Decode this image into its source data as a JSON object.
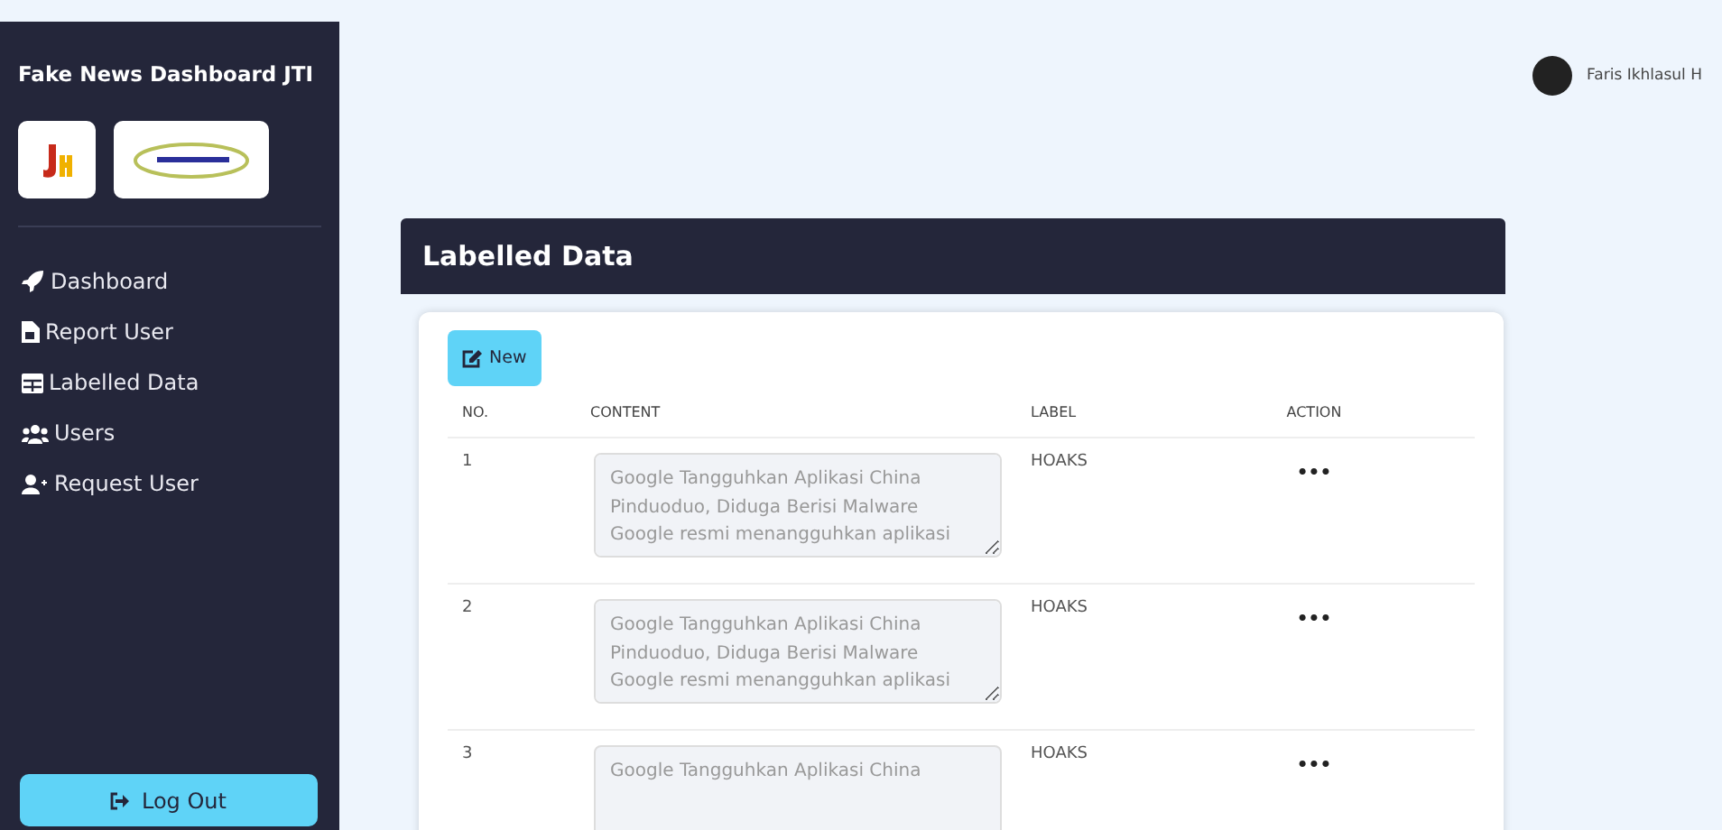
{
  "sidebar": {
    "title": "Fake News Dashboard JTI",
    "nav": [
      {
        "label": "Dashboard"
      },
      {
        "label": "Report User"
      },
      {
        "label": "Labelled Data"
      },
      {
        "label": "Users"
      },
      {
        "label": "Request User"
      }
    ],
    "logout": "Log Out"
  },
  "user": {
    "name": "Faris Ikhlasul H"
  },
  "page": {
    "title": "Labelled Data",
    "new_button": "New",
    "table": {
      "columns": [
        "NO.",
        "CONTENT",
        "LABEL",
        "ACTION"
      ],
      "rows": [
        {
          "no": "1",
          "content": "Google Tangguhkan Aplikasi China Pinduoduo, Diduga Berisi Malware Google resmi menangguhkan aplikasi",
          "label": "HOAKS",
          "action": "•••"
        },
        {
          "no": "2",
          "content": "Google Tangguhkan Aplikasi China Pinduoduo, Diduga Berisi Malware Google resmi menangguhkan aplikasi",
          "label": "HOAKS",
          "action": "•••"
        },
        {
          "no": "3",
          "content": "Google Tangguhkan Aplikasi China",
          "label": "HOAKS",
          "action": "•••"
        }
      ]
    }
  }
}
